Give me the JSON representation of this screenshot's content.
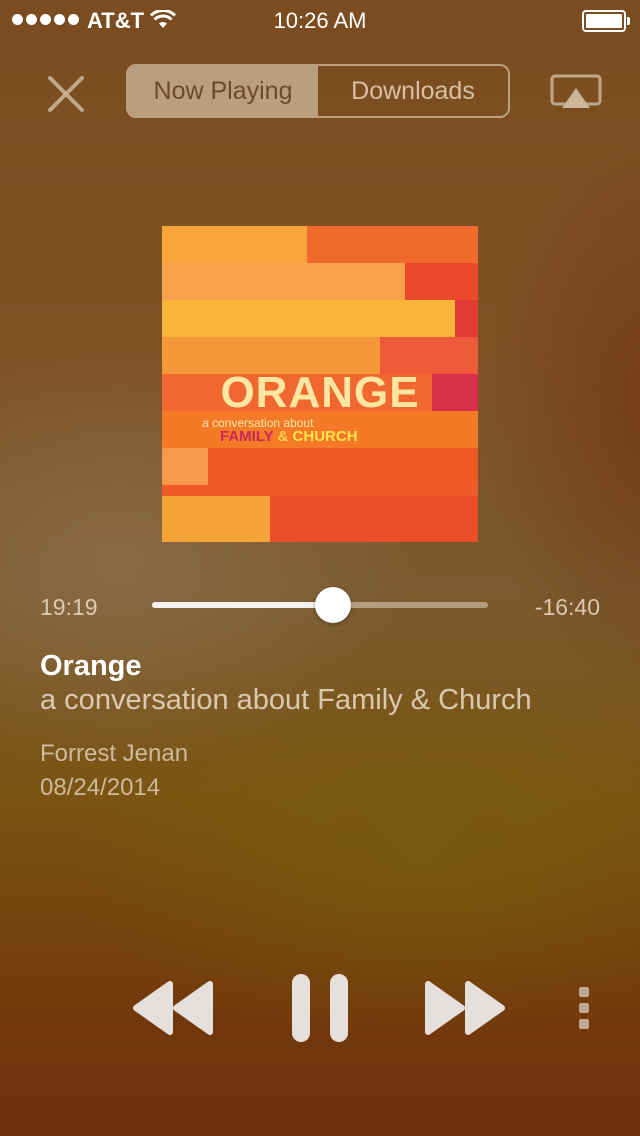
{
  "status_bar": {
    "carrier": "AT&T",
    "time": "10:26 AM",
    "signal_bars": 5,
    "icons": [
      "wifi-icon",
      "battery-icon"
    ]
  },
  "top_bar": {
    "close_icon": "close-icon",
    "segments": [
      {
        "label": "Now Playing",
        "active": true
      },
      {
        "label": "Downloads",
        "active": false
      }
    ],
    "airplay_icon": "airplay-icon"
  },
  "artwork": {
    "title": "ORANGE",
    "subtitle": "a conversation about",
    "family": "FAMILY",
    "amp": "&",
    "church": "CHURCH"
  },
  "player": {
    "elapsed": "19:19",
    "remaining": "-16:40",
    "progress": 0.54
  },
  "track": {
    "title": "Orange",
    "subtitle": "a conversation about Family & Church",
    "author": "Forrest Jenan",
    "date": "08/24/2014"
  },
  "controls": {
    "icons": [
      "rewind-icon",
      "pause-icon",
      "fast-forward-icon",
      "more-icon"
    ]
  },
  "colors": {
    "accent": "#f26c2a",
    "text_muted": "#ebdcc8"
  }
}
